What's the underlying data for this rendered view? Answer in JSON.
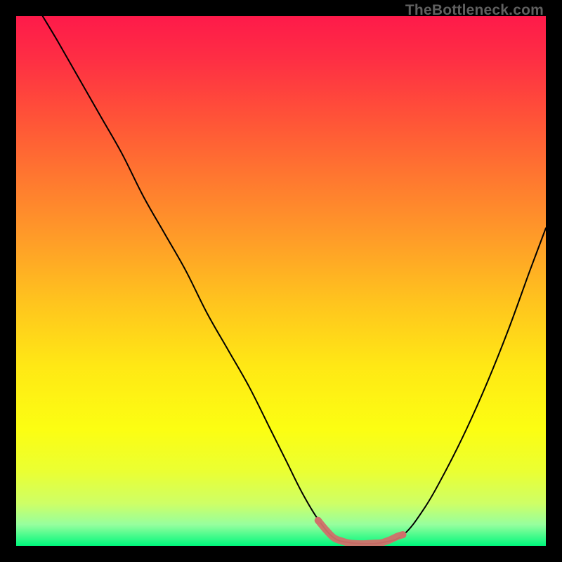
{
  "attribution": "TheBottleneck.com",
  "chart_data": {
    "type": "line",
    "title": "",
    "xlabel": "",
    "ylabel": "",
    "xlim": [
      0,
      100
    ],
    "ylim": [
      0,
      100
    ],
    "grid": false,
    "legend": false,
    "background_gradient": {
      "stops": [
        {
          "offset": 0.0,
          "color": "#fe1a4a"
        },
        {
          "offset": 0.08,
          "color": "#fe2e44"
        },
        {
          "offset": 0.19,
          "color": "#ff5238"
        },
        {
          "offset": 0.3,
          "color": "#ff7630"
        },
        {
          "offset": 0.42,
          "color": "#ff9c28"
        },
        {
          "offset": 0.54,
          "color": "#ffc41e"
        },
        {
          "offset": 0.66,
          "color": "#ffe815"
        },
        {
          "offset": 0.78,
          "color": "#fcfe12"
        },
        {
          "offset": 0.86,
          "color": "#eaff33"
        },
        {
          "offset": 0.92,
          "color": "#ceff66"
        },
        {
          "offset": 0.96,
          "color": "#96ff9e"
        },
        {
          "offset": 1.0,
          "color": "#00f77c"
        }
      ]
    },
    "series": [
      {
        "name": "bottleneck-curve",
        "stroke": "#000000",
        "stroke_width": 2,
        "x": [
          5,
          8,
          12,
          16,
          20,
          24,
          28,
          32,
          36,
          40,
          44,
          48,
          51,
          54,
          57,
          60,
          63,
          66,
          69,
          73,
          77,
          81,
          85,
          89,
          93,
          97,
          100
        ],
        "y": [
          100,
          95,
          88,
          81,
          74,
          66,
          59,
          52,
          44,
          37,
          30,
          22,
          16,
          10,
          5,
          1.5,
          0.6,
          0.4,
          0.6,
          2.0,
          7,
          14,
          22,
          31,
          41,
          52,
          60
        ]
      },
      {
        "name": "optimal-band-highlight",
        "stroke": "#d1706a",
        "stroke_width": 10,
        "x": [
          57.0,
          58.5,
          60.0,
          61.5,
          63.0,
          64.5,
          66.0,
          67.5,
          69.0,
          70.5,
          72.0,
          73.0
        ],
        "y": [
          4.8,
          3.0,
          1.5,
          0.9,
          0.5,
          0.4,
          0.4,
          0.5,
          0.6,
          1.1,
          1.8,
          2.1
        ]
      }
    ]
  }
}
